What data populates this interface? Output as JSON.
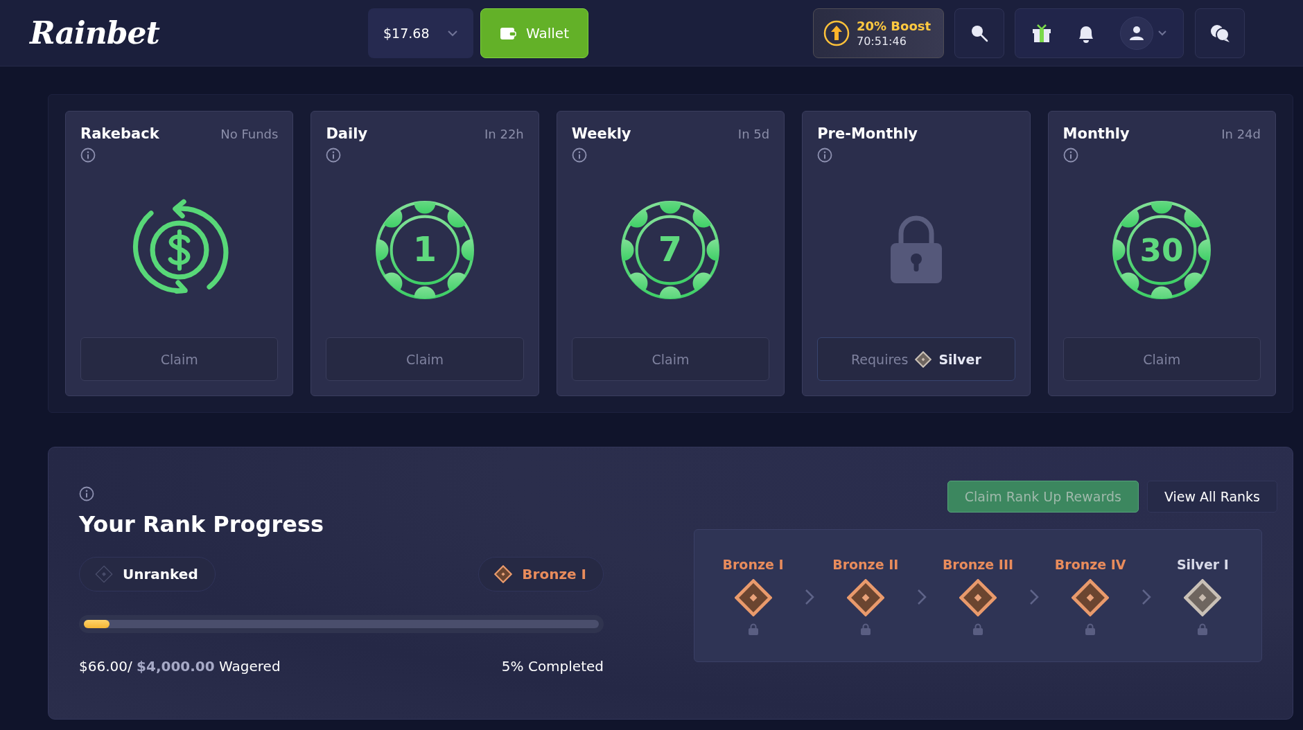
{
  "header": {
    "logo": "Rainbet",
    "balance": "$17.68",
    "wallet_button": "Wallet",
    "boost": {
      "title": "20% Boost",
      "timer": "70:51:46"
    }
  },
  "rewards": [
    {
      "title": "Rakeback",
      "status": "No Funds",
      "kind": "rakeback",
      "action": {
        "kind": "claim",
        "label": "Claim"
      }
    },
    {
      "title": "Daily",
      "status": "In 22h",
      "kind": "chip",
      "chip": "1",
      "action": {
        "kind": "claim",
        "label": "Claim"
      }
    },
    {
      "title": "Weekly",
      "status": "In 5d",
      "kind": "chip",
      "chip": "7",
      "action": {
        "kind": "claim",
        "label": "Claim"
      }
    },
    {
      "title": "Pre-Monthly",
      "kind": "locked",
      "action": {
        "kind": "requires",
        "label": "Requires",
        "rank": "Silver"
      }
    },
    {
      "title": "Monthly",
      "status": "In 24d",
      "kind": "chip",
      "chip": "30",
      "action": {
        "kind": "claim",
        "label": "Claim"
      }
    }
  ],
  "rank_progress": {
    "title": "Your Rank Progress",
    "current": {
      "label": "Unranked",
      "kind": "none"
    },
    "next": {
      "label": "Bronze I",
      "kind": "bronze"
    },
    "level": 0.05,
    "wagered": "$66.00/ **$4,000.00** Wagered",
    "completed": "5% Completed",
    "buttons": [
      {
        "label": "Claim Rank Up Rewards",
        "kind": "primary"
      },
      {
        "label": "View All Ranks",
        "kind": "secondary"
      }
    ],
    "ranks": [
      {
        "name": "Bronze I",
        "kind": "bronze",
        "locked": true
      },
      {
        "name": "Bronze II",
        "kind": "bronze",
        "locked": true
      },
      {
        "name": "Bronze III",
        "kind": "bronze",
        "locked": true
      },
      {
        "name": "Bronze IV",
        "kind": "bronze",
        "locked": true
      },
      {
        "name": "Silver I",
        "kind": "silver",
        "locked": true
      }
    ]
  }
}
